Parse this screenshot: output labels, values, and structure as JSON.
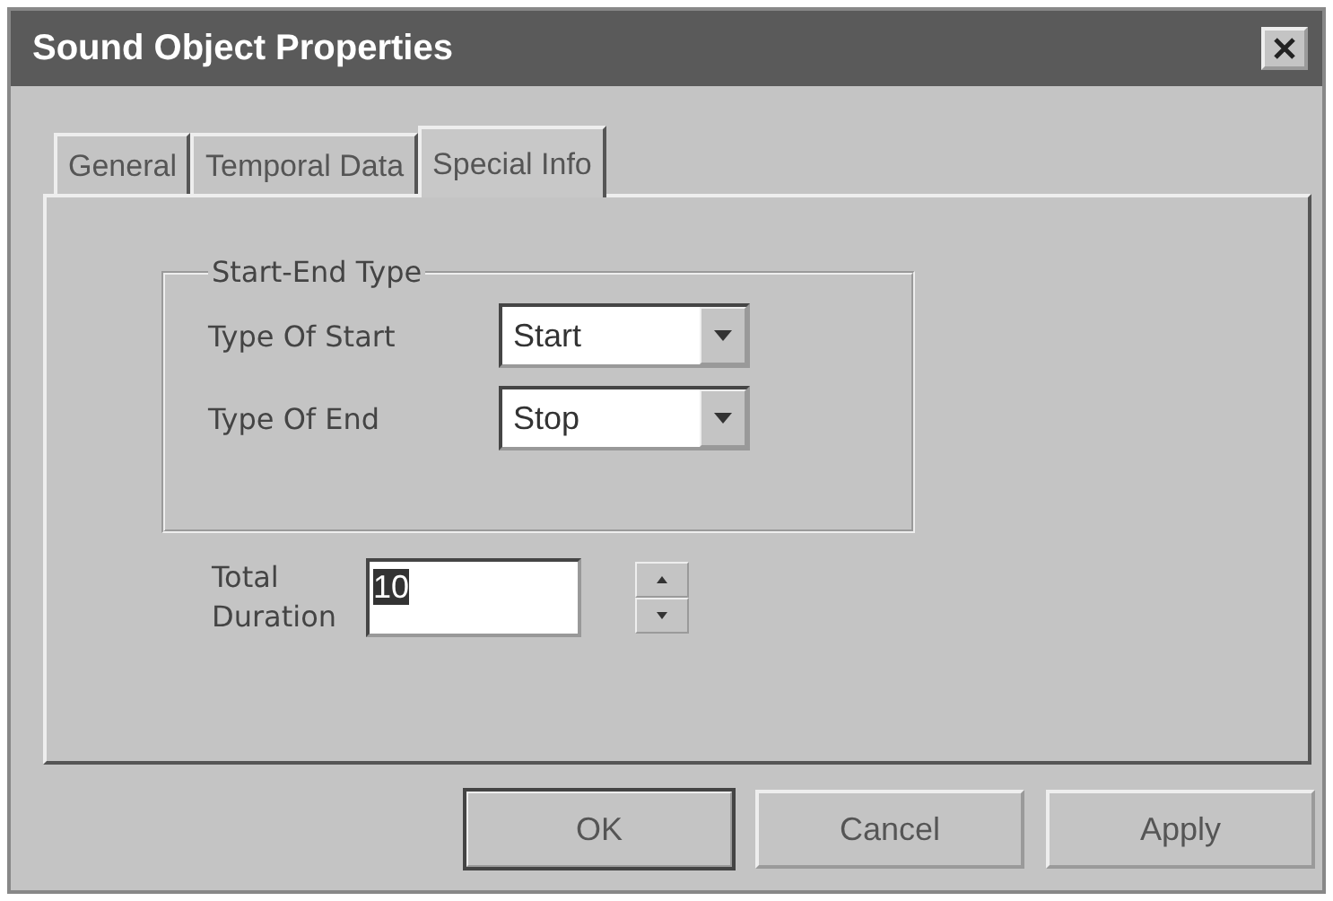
{
  "window": {
    "title": "Sound Object Properties"
  },
  "tabs": [
    {
      "label": "General",
      "selected": false
    },
    {
      "label": "Temporal Data",
      "selected": false
    },
    {
      "label": "Special Info",
      "selected": true
    }
  ],
  "group": {
    "title": "Start-End Type",
    "fields": [
      {
        "label": "Type Of Start",
        "value": "Start"
      },
      {
        "label": "Type Of End",
        "value": "Stop"
      }
    ]
  },
  "duration": {
    "label": "Total Duration",
    "value": "10"
  },
  "buttons": [
    "OK",
    "Cancel",
    "Apply"
  ]
}
